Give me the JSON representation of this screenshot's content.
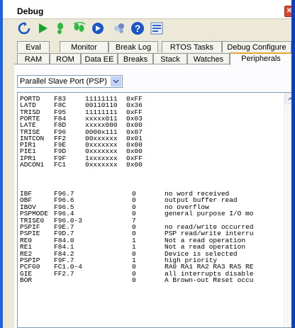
{
  "window": {
    "title": "Debug",
    "close_glyph": "✕"
  },
  "toolbar": {
    "icons": [
      "refresh-icon",
      "run-icon",
      "step-into-icon",
      "step-over-icon",
      "animate-icon",
      "breakpoints-icon",
      "help-icon",
      "options-icon"
    ]
  },
  "tabs_top": [
    "Eval",
    "Monitor",
    "Break Log",
    "RTOS Tasks",
    "Debug Configure"
  ],
  "tabs_bottom": [
    "RAM",
    "ROM",
    "Data EE",
    "Breaks",
    "Stack",
    "Watches",
    "Peripherals"
  ],
  "active_tab": "Peripherals",
  "peripheral_select": {
    "value": "Parallel Slave Port (PSP)"
  },
  "registers": [
    {
      "name": "PORTD",
      "addr": "F83",
      "bin": "11111111",
      "hex": "0xFF"
    },
    {
      "name": "LATD",
      "addr": "F8C",
      "bin": "00110110",
      "hex": "0x36"
    },
    {
      "name": "TRISD",
      "addr": "F95",
      "bin": "11111111",
      "hex": "0xFF"
    },
    {
      "name": "PORTE",
      "addr": "F84",
      "bin": "xxxxx011",
      "hex": "0x03"
    },
    {
      "name": "LATE",
      "addr": "F8D",
      "bin": "xxxxx000",
      "hex": "0x00"
    },
    {
      "name": "TRISE",
      "addr": "F96",
      "bin": "0000x111",
      "hex": "0x07"
    },
    {
      "name": "INTCON",
      "addr": "FF2",
      "bin": "00xxxxxx",
      "hex": "0x01"
    },
    {
      "name": "PIR1",
      "addr": "F9E",
      "bin": "0xxxxxxx",
      "hex": "0x00"
    },
    {
      "name": "PIE1",
      "addr": "F9D",
      "bin": "0xxxxxxx",
      "hex": "0x00"
    },
    {
      "name": "IPR1",
      "addr": "F9F",
      "bin": "1xxxxxxx",
      "hex": "0xFF"
    },
    {
      "name": "ADCON1",
      "addr": "FC1",
      "bin": "0xxxxxxx",
      "hex": "0x00"
    }
  ],
  "bits": [
    {
      "name": "IBF",
      "loc": "F96.7",
      "val": "0",
      "desc": "no word received"
    },
    {
      "name": "OBF",
      "loc": "F96.6",
      "val": "0",
      "desc": "output buffer read"
    },
    {
      "name": "IBOV",
      "loc": "F96.5",
      "val": "0",
      "desc": "no overflow"
    },
    {
      "name": "PSPMODE",
      "loc": "F96.4",
      "val": "0",
      "desc": "general purpose I/O mo"
    },
    {
      "name": "TRISE0",
      "loc": "F96.0-3",
      "val": "7",
      "desc": ""
    },
    {
      "name": "PSPIF",
      "loc": "F9E.7",
      "val": "0",
      "desc": "no read/write occurred"
    },
    {
      "name": "PSPIE",
      "loc": "F9D.7",
      "val": "0",
      "desc": "PSP read/write interru"
    },
    {
      "name": "RE0",
      "loc": "F84.0",
      "val": "1",
      "desc": "Not a read operation"
    },
    {
      "name": "RE1",
      "loc": "F84.1",
      "val": "1",
      "desc": "Not a read operation"
    },
    {
      "name": "RE2",
      "loc": "F84.2",
      "val": "0",
      "desc": "Device is selected"
    },
    {
      "name": "PSPIP",
      "loc": "F9F.7",
      "val": "1",
      "desc": "high priority"
    },
    {
      "name": "PCFG0",
      "loc": "FC1.0-4",
      "val": "0",
      "desc": "RA0 RA1 RA2 RA3 RA5 RE"
    },
    {
      "name": "GIE",
      "loc": "FF2.7",
      "val": "0",
      "desc": "all interrupts disable"
    },
    {
      "name": "BOR",
      "loc": "",
      "val": "0",
      "desc": "A Brown-out Reset occu"
    }
  ],
  "colors": {
    "accent_blue": "#0a4ccf",
    "window_bg": "#ece9d8",
    "active_tab_highlight": "#e6a43c"
  }
}
